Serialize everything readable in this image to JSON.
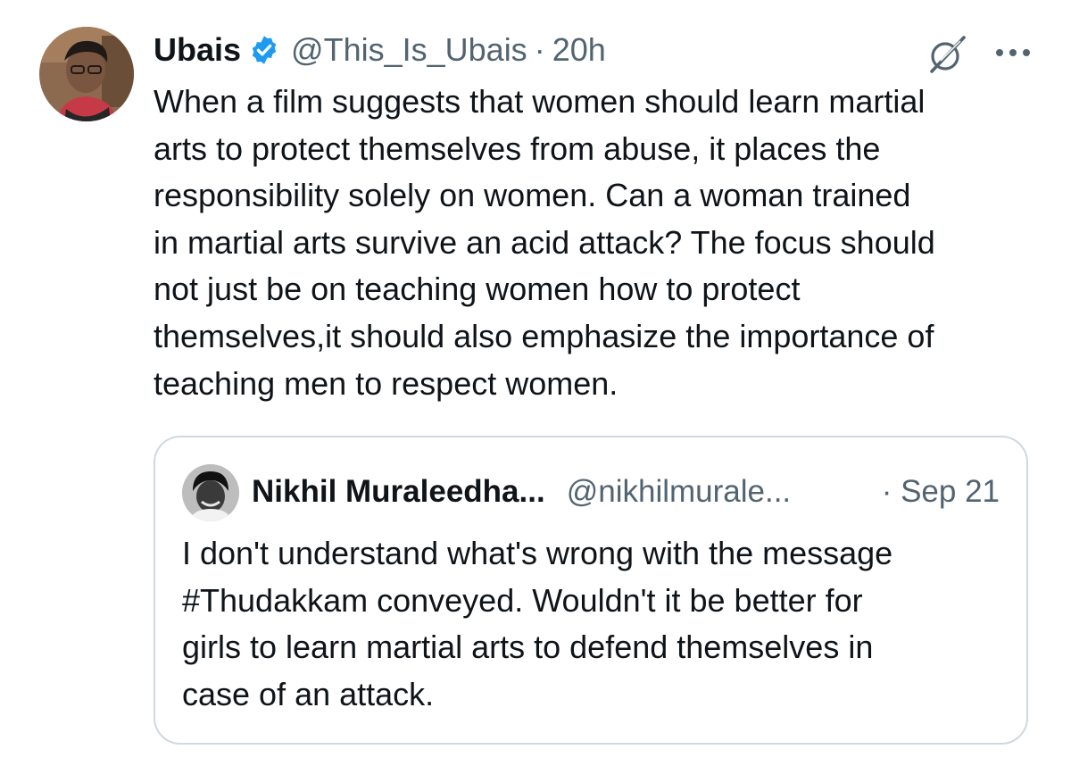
{
  "tweet": {
    "author_name": "Ubais",
    "author_handle": "@This_Is_Ubais",
    "separator": "·",
    "time": "20h",
    "text": "When a film suggests that women should learn martial\narts to protect themselves from abuse, it places the\nresponsibility solely on women.  Can a woman trained\nin martial arts survive an acid attack? The focus should\nnot just be on teaching women how to protect\nthemselves,it should also emphasize the importance of\nteaching men to respect women.",
    "verified": true,
    "icons": {
      "verified": "verified-badge-icon",
      "grok": "grok-icon",
      "more": "more-options-icon"
    }
  },
  "quoted_tweet": {
    "author_name": "Nikhil Muraleedha...",
    "author_handle": "@nikhilmurale...",
    "time": "· Sep 21",
    "text": "I don't understand what's wrong with the message\n#Thudakkam conveyed. Wouldn't it be better for\ngirls to learn martial arts to defend themselves in\ncase of an attack."
  },
  "colors": {
    "text_primary": "#0f1419",
    "text_secondary": "#536471",
    "verified_blue": "#1d9bf0",
    "border": "#cfd9de"
  }
}
